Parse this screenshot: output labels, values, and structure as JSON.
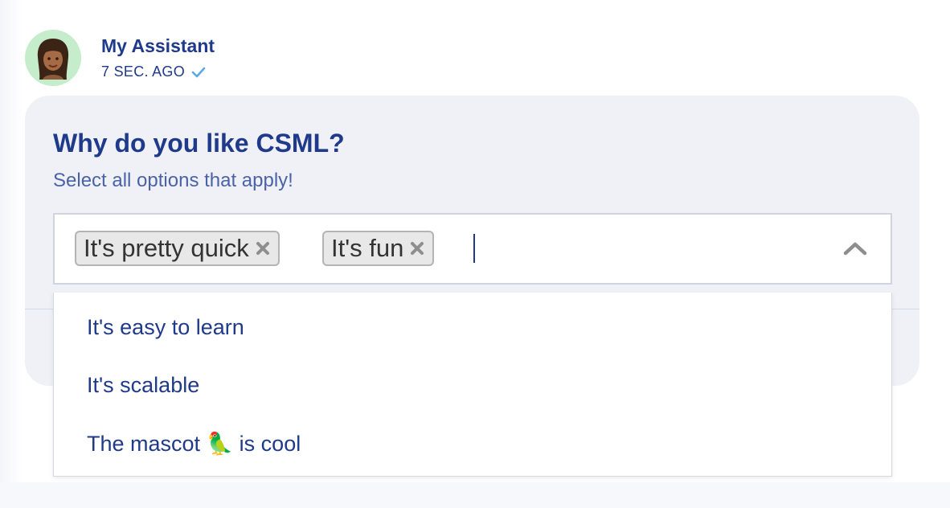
{
  "bot": {
    "name": "My Assistant",
    "timestamp": "7 SEC. AGO",
    "status_icon": "checkmark-icon",
    "avatar_icon": "memoji-avatar"
  },
  "question": {
    "title": "Why do you like CSML?",
    "subtitle": "Select all options that apply!"
  },
  "multiselect": {
    "selected": [
      {
        "label": "It's pretty quick",
        "remove_icon": "close-icon"
      },
      {
        "label": "It's fun",
        "remove_icon": "close-icon"
      }
    ],
    "toggle_icon": "chevron-up-icon",
    "options": [
      {
        "label": "It's easy to learn"
      },
      {
        "label": "It's scalable"
      },
      {
        "label": "The mascot 🦜 is cool"
      }
    ]
  },
  "colors": {
    "primary": "#1f3a8a",
    "subtitle": "#4a63a8",
    "card_bg": "#eff1f6",
    "avatar_bg": "#c5edcb",
    "check": "#5aa9e6",
    "chip_bg": "#e8e8e8"
  }
}
